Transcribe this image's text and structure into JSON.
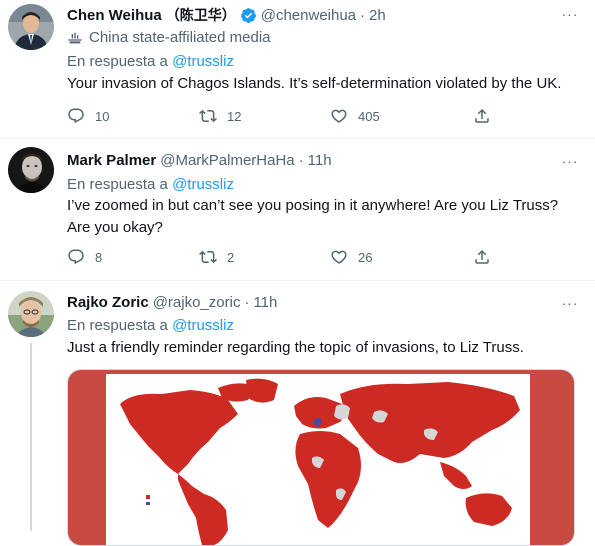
{
  "tweets": [
    {
      "name": "Chen Weihua",
      "name_cjk": "（陈卫华）",
      "handle": "@chenweihua",
      "time": "2h",
      "affiliation": "China state-affiliated media",
      "reply_prefix": "En respuesta a",
      "reply_to": "@trussliz",
      "text": "Your invasion of Chagos Islands. It’s self-determination violated by the UK.",
      "replies": "10",
      "retweets": "12",
      "likes": "405"
    },
    {
      "name": "Mark Palmer",
      "handle": "@MarkPalmerHaHa",
      "time": "11h",
      "reply_prefix": "En respuesta a",
      "reply_to": "@trussliz",
      "text_line1": "I’ve zoomed in but can’t see you posing in it anywhere! Are you Liz Truss?",
      "text_line2": "Are you okay?",
      "replies": "8",
      "retweets": "2",
      "likes": "26"
    },
    {
      "name": "Rajko Zoric",
      "handle": "@rajko_zoric",
      "time": "11h",
      "reply_prefix": "En respuesta a",
      "reply_to": "@trussliz",
      "text": "Just a friendly reminder regarding the topic of invasions, to Liz Truss."
    }
  ],
  "separator": "·",
  "more_glyph": "···",
  "colors": {
    "link": "#1d9bf0",
    "muted": "#536471",
    "text": "#0f1419",
    "verified": "#1d9bf0",
    "map_ocean": "#ffffff",
    "map_land": "#cc2a22"
  },
  "icons": [
    "reply-icon",
    "retweet-icon",
    "like-icon",
    "share-icon",
    "verified-icon",
    "media-flag-icon",
    "more-icon"
  ]
}
